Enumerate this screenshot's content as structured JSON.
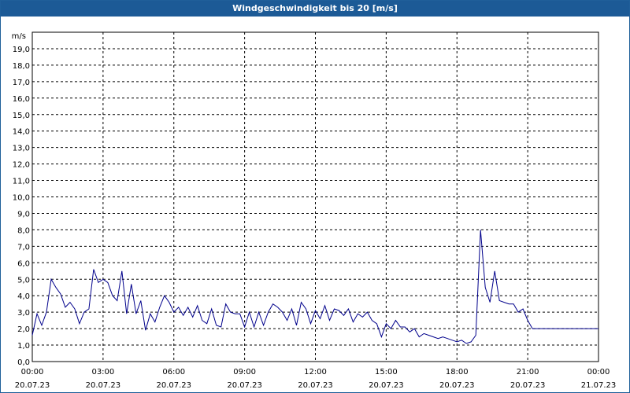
{
  "title": "Windgeschwindigkeit bis 20 [m/s]",
  "chart_data": {
    "type": "line",
    "title": "Windgeschwindigkeit bis 20 [m/s]",
    "ylabel": "m/s",
    "xlabel": "",
    "ylim": [
      0,
      20
    ],
    "xlim": [
      0,
      1440
    ],
    "grid": true,
    "line_color": "#00008b",
    "y_ticks": [
      "0,0",
      "1,0",
      "2,0",
      "3,0",
      "4,0",
      "5,0",
      "6,0",
      "7,0",
      "8,0",
      "9,0",
      "10,0",
      "11,0",
      "12,0",
      "13,0",
      "14,0",
      "15,0",
      "16,0",
      "17,0",
      "18,0",
      "19,0"
    ],
    "x_ticks": [
      {
        "time": "00:00",
        "date": "20.07.23"
      },
      {
        "time": "03:00",
        "date": "20.07.23"
      },
      {
        "time": "06:00",
        "date": "20.07.23"
      },
      {
        "time": "09:00",
        "date": "20.07.23"
      },
      {
        "time": "12:00",
        "date": "20.07.23"
      },
      {
        "time": "15:00",
        "date": "20.07.23"
      },
      {
        "time": "18:00",
        "date": "20.07.23"
      },
      {
        "time": "21:00",
        "date": "20.07.23"
      },
      {
        "time": "00:00",
        "date": "21.07.23"
      }
    ],
    "series": [
      {
        "x": [
          0,
          12,
          24,
          36,
          48,
          60,
          72,
          84,
          96,
          108,
          120,
          132,
          144,
          156,
          168,
          180,
          192,
          204,
          216,
          228,
          240,
          252,
          264,
          276,
          288,
          300,
          312,
          324,
          336,
          348,
          360,
          372,
          384,
          396,
          408,
          420,
          432,
          444,
          456,
          468,
          480,
          492,
          504,
          516,
          528,
          540,
          552,
          564,
          576,
          588,
          600,
          612,
          624,
          636,
          648,
          660,
          672,
          684,
          696,
          708,
          720,
          732,
          744,
          756,
          768,
          780,
          792,
          804,
          816,
          828,
          840,
          852,
          864,
          876,
          888,
          900,
          912,
          924,
          936,
          948,
          960,
          972,
          984,
          996,
          1008,
          1020,
          1032,
          1044,
          1056,
          1068,
          1080,
          1092,
          1104,
          1116,
          1128,
          1140,
          1152,
          1164,
          1176,
          1188,
          1200,
          1212,
          1224,
          1236,
          1248,
          1260,
          1272,
          1284,
          1296,
          1308,
          1320,
          1332,
          1344,
          1356,
          1368,
          1380,
          1392,
          1404,
          1416,
          1428,
          1440
        ],
        "y": [
          1.6,
          2.9,
          2.2,
          3.0,
          5.0,
          4.5,
          4.1,
          3.3,
          3.6,
          3.2,
          2.3,
          3.0,
          3.2,
          5.6,
          4.8,
          5.0,
          4.8,
          4.0,
          3.7,
          5.5,
          2.9,
          4.7,
          2.9,
          3.7,
          1.9,
          2.9,
          2.4,
          3.3,
          4.0,
          3.6,
          3.0,
          3.3,
          2.8,
          3.3,
          2.7,
          3.4,
          2.5,
          2.3,
          3.2,
          2.2,
          2.1,
          3.5,
          3.0,
          2.9,
          2.9,
          2.1,
          3.0,
          2.1,
          3.0,
          2.2,
          3.0,
          3.5,
          3.3,
          3.0,
          2.5,
          3.2,
          2.2,
          3.6,
          3.2,
          2.3,
          3.1,
          2.6,
          3.4,
          2.5,
          3.2,
          3.1,
          2.8,
          3.2,
          2.4,
          2.9,
          2.7,
          3.0,
          2.5,
          2.3,
          1.5,
          2.3,
          2.0,
          2.5,
          2.1,
          2.1,
          1.8,
          2.0,
          1.5,
          1.7,
          1.6,
          1.5,
          1.4,
          1.5,
          1.4,
          1.3,
          1.2,
          1.3,
          1.1,
          1.2,
          1.6,
          8.0,
          4.5,
          3.6,
          5.5,
          3.7,
          3.6,
          3.5,
          3.5,
          3.0,
          3.2,
          2.5,
          2.0,
          2.0,
          2.0,
          2.0,
          2.0,
          2.0,
          2.0,
          2.0,
          2.0,
          2.0,
          2.0,
          2.0,
          2.0,
          2.0,
          2.0
        ]
      }
    ]
  }
}
